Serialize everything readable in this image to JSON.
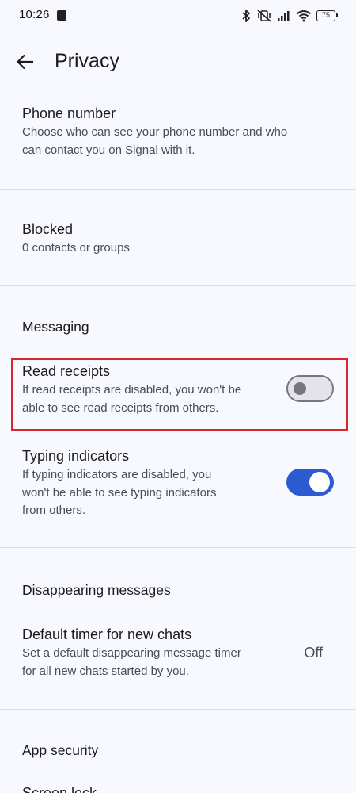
{
  "status_bar": {
    "time": "10:26",
    "battery": "75",
    "icons": [
      "notification-square-icon",
      "bluetooth-icon",
      "vibrate-off-icon",
      "signal-icon",
      "wifi-icon",
      "battery-icon"
    ]
  },
  "app_bar": {
    "title": "Privacy",
    "back_icon": "arrow-left-icon"
  },
  "phone_number": {
    "title": "Phone number",
    "desc_line1": "Choose who can see your phone number and who",
    "desc_line2": "can contact you on Signal with it."
  },
  "blocked": {
    "title": "Blocked",
    "desc": "0 contacts or groups"
  },
  "messaging": {
    "header": "Messaging",
    "read_receipts": {
      "title": "Read receipts",
      "desc_line1": "If read receipts are disabled, you won't be",
      "desc_line2": "able to see read receipts from others.",
      "enabled": false
    },
    "typing_indicators": {
      "title": "Typing indicators",
      "desc_line1": "If typing indicators are disabled, you",
      "desc_line2": "won't be able to see typing indicators",
      "desc_line3": "from others.",
      "enabled": true
    }
  },
  "disappearing": {
    "header": "Disappearing messages",
    "default_timer": {
      "title": "Default timer for new chats",
      "desc_line1": "Set a default disappearing message timer",
      "desc_line2": "for all new chats started by you.",
      "value": "Off"
    }
  },
  "app_security": {
    "header": "App security",
    "next_item": "Screen lock"
  },
  "colors": {
    "accent": "#2c5ad0",
    "highlight": "#d7262e",
    "background": "#f8f9fe"
  }
}
